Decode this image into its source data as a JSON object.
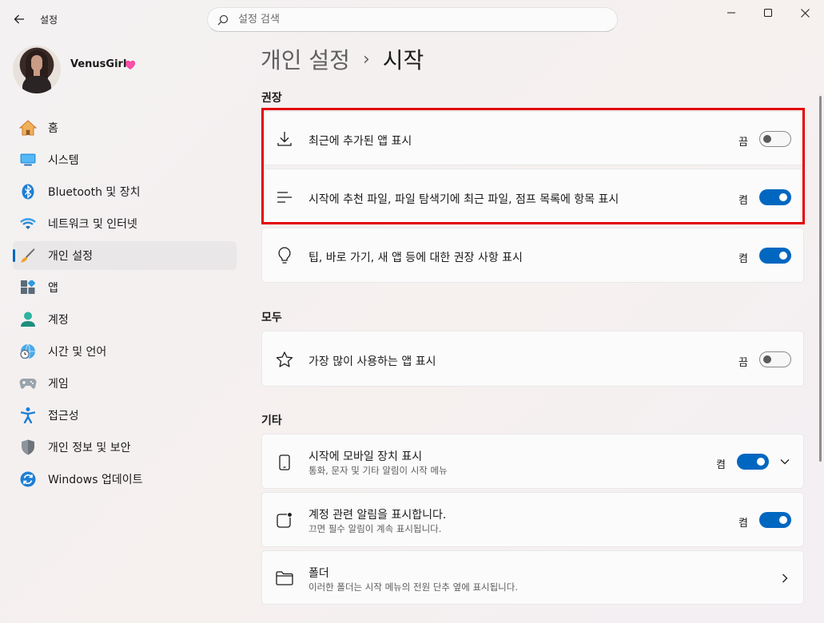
{
  "window": {
    "title": "설정"
  },
  "search": {
    "placeholder": "설정 검색"
  },
  "profile": {
    "name": "VenusGirl"
  },
  "nav": {
    "items": [
      {
        "label": "홈",
        "icon": "home-icon"
      },
      {
        "label": "시스템",
        "icon": "monitor-icon"
      },
      {
        "label": "Bluetooth 및 장치",
        "icon": "bluetooth-icon"
      },
      {
        "label": "네트워크 및 인터넷",
        "icon": "wifi-icon"
      },
      {
        "label": "개인 설정",
        "icon": "brush-icon",
        "active": true
      },
      {
        "label": "앱",
        "icon": "apps-icon"
      },
      {
        "label": "계정",
        "icon": "person-icon"
      },
      {
        "label": "시간 및 언어",
        "icon": "globe-clock-icon"
      },
      {
        "label": "게임",
        "icon": "gamepad-icon"
      },
      {
        "label": "접근성",
        "icon": "accessibility-icon"
      },
      {
        "label": "개인 정보 및 보안",
        "icon": "shield-icon"
      },
      {
        "label": "Windows 업데이트",
        "icon": "update-icon"
      }
    ]
  },
  "breadcrumb": {
    "parent": "개인 설정",
    "separator": "›",
    "current": "시작"
  },
  "sections": {
    "recommended": "권장",
    "all": "모두",
    "other": "기타"
  },
  "settings": {
    "recent_apps": {
      "title": "최근에 추가된 앱 표시",
      "state": "끔",
      "on": false
    },
    "recommended_files": {
      "title": "시작에 추천 파일, 파일 탐색기에 최근 파일, 점프 목록에 항목 표시",
      "state": "켬",
      "on": true
    },
    "tips": {
      "title": "팁, 바로 가기, 새 앱 등에 대한 권장 사항 표시",
      "state": "켬",
      "on": true
    },
    "most_used": {
      "title": "가장 많이 사용하는 앱 표시",
      "state": "끔",
      "on": false
    },
    "mobile": {
      "title": "시작에 모바일 장치 표시",
      "subtitle": "통화, 문자 및 기타 알림이 시작 메뉴",
      "state": "켬",
      "on": true
    },
    "account_notif": {
      "title": "계정 관련 알림을 표시합니다.",
      "subtitle": "끄면 필수 알림이 계속 표시됩니다.",
      "state": "켬",
      "on": true
    },
    "folders": {
      "title": "폴더",
      "subtitle": "이러한 폴더는 시작 메뉴의 전원 단추 옆에 표시됩니다."
    }
  },
  "colors": {
    "accent": "#0067c0",
    "highlight": "#e30000"
  }
}
